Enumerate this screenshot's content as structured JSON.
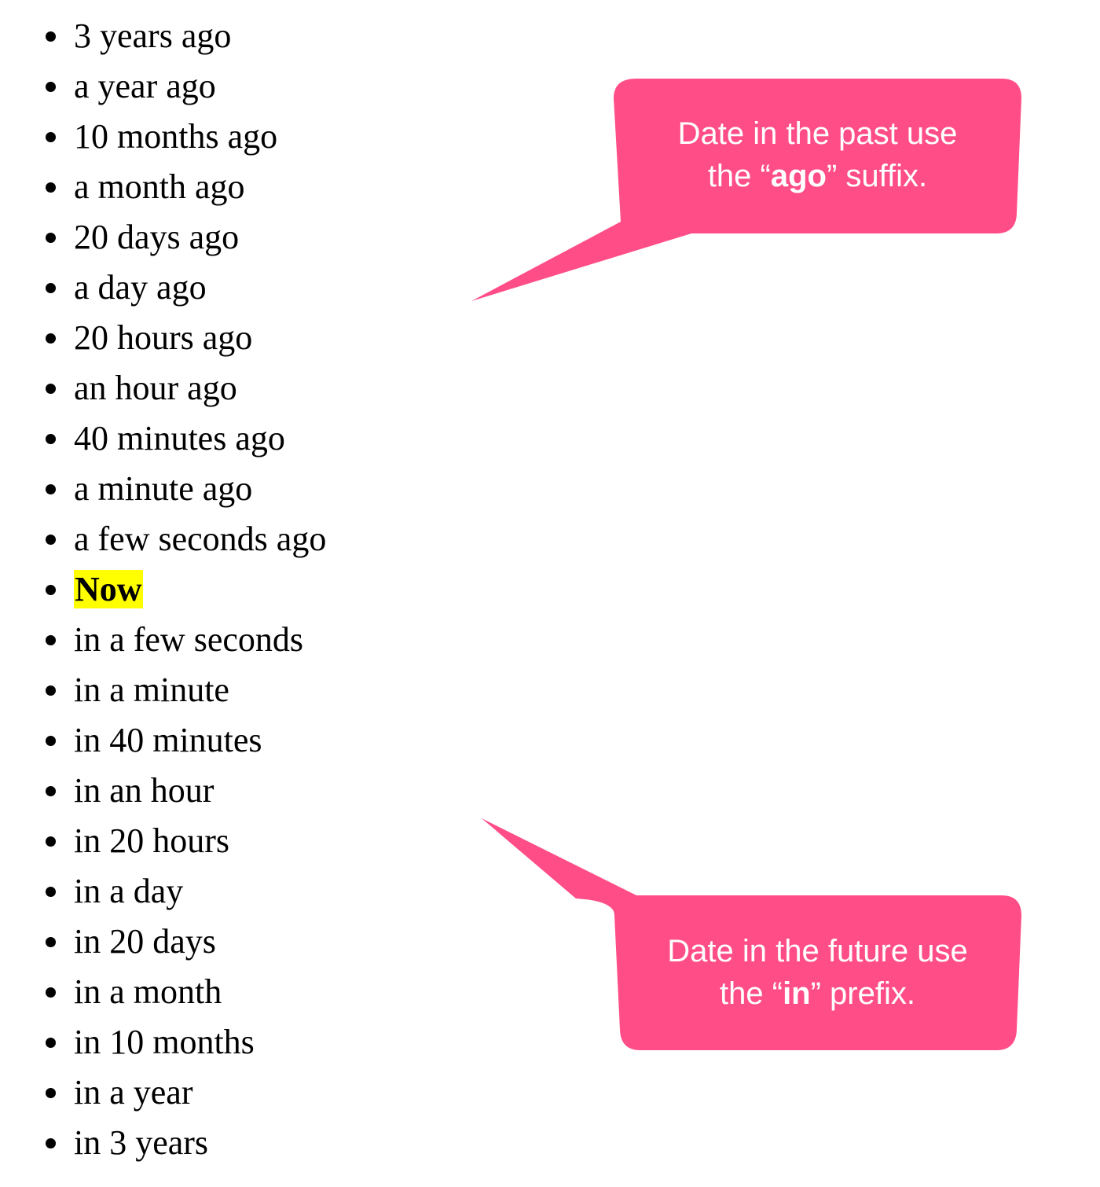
{
  "list": {
    "items": [
      "3 years ago",
      "a year ago",
      "10 months ago",
      "a month ago",
      "20 days ago",
      "a day ago",
      "20 hours ago",
      "an hour ago",
      "40 minutes ago",
      "a minute ago",
      "a few seconds ago",
      "Now",
      "in a few seconds",
      "in a minute",
      "in 40 minutes",
      "in an hour",
      "in 20 hours",
      "in a day",
      "in 20 days",
      "in a month",
      "in 10 months",
      "in a year",
      "in 3 years"
    ],
    "highlight_index": 11,
    "highlight_color": "#ffff00"
  },
  "callouts": {
    "color": "#ff4d88",
    "past": {
      "line1": "Date in the past use",
      "line2_pre": "the “",
      "line2_bold": "ago",
      "line2_post": "” suffix."
    },
    "future": {
      "line1": "Date in the future use",
      "line2_pre": "the “",
      "line2_bold": "in",
      "line2_post": "” prefix."
    }
  }
}
